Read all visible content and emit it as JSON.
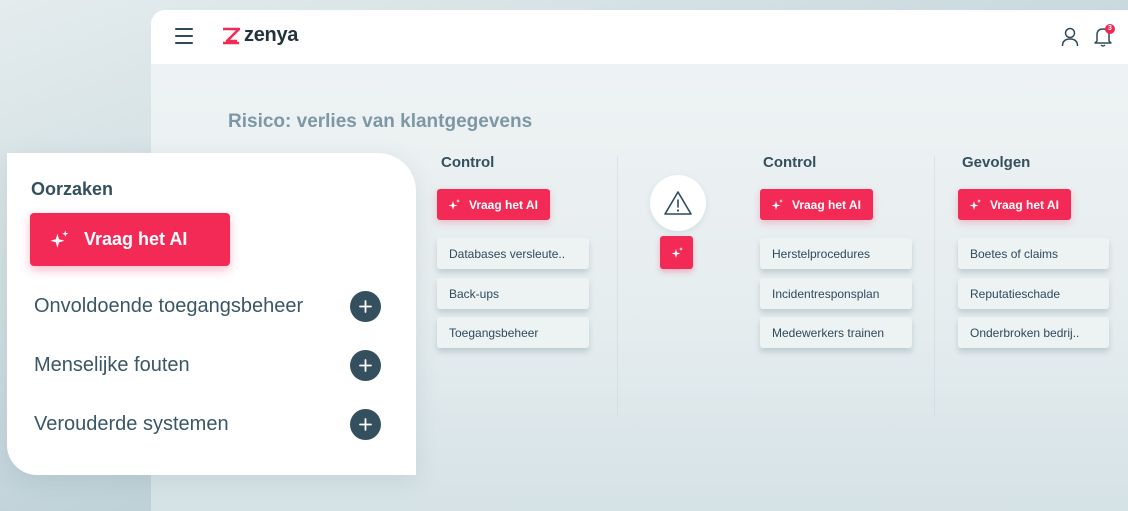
{
  "app": {
    "logo_text": "zenya",
    "notification_count": "3"
  },
  "risk": {
    "title": "Risico: verlies van klantgegevens"
  },
  "columns": [
    {
      "heading": "Control",
      "ai_label": "Vraag het AI",
      "items": [
        "Databases versleute..",
        "Back-ups",
        "Toegangsbeheer"
      ]
    },
    {
      "heading": "Control",
      "ai_label": "Vraag het AI",
      "items": [
        "Herstelprocedures",
        "Incidentresponsplan",
        "Medewerkers trainen"
      ]
    },
    {
      "heading": "Gevolgen",
      "ai_label": "Vraag het AI",
      "items": [
        "Boetes of claims",
        "Reputatieschade",
        "Onderbroken bedrij.."
      ]
    }
  ],
  "causes": {
    "heading": "Oorzaken",
    "ai_label": "Vraag het AI",
    "items": [
      "Onvoldoende toegangsbeheer",
      "Menselijke fouten",
      "Verouderde systemen"
    ]
  },
  "icons": {
    "menu": "hamburger-icon",
    "user": "user-icon",
    "bell": "bell-icon",
    "warning": "warning-triangle-icon",
    "sparkle": "sparkle-icon",
    "plus": "plus-icon"
  },
  "colors": {
    "accent": "#f22a55",
    "text_dark": "#34505f",
    "title_muted": "#7d97a4"
  }
}
